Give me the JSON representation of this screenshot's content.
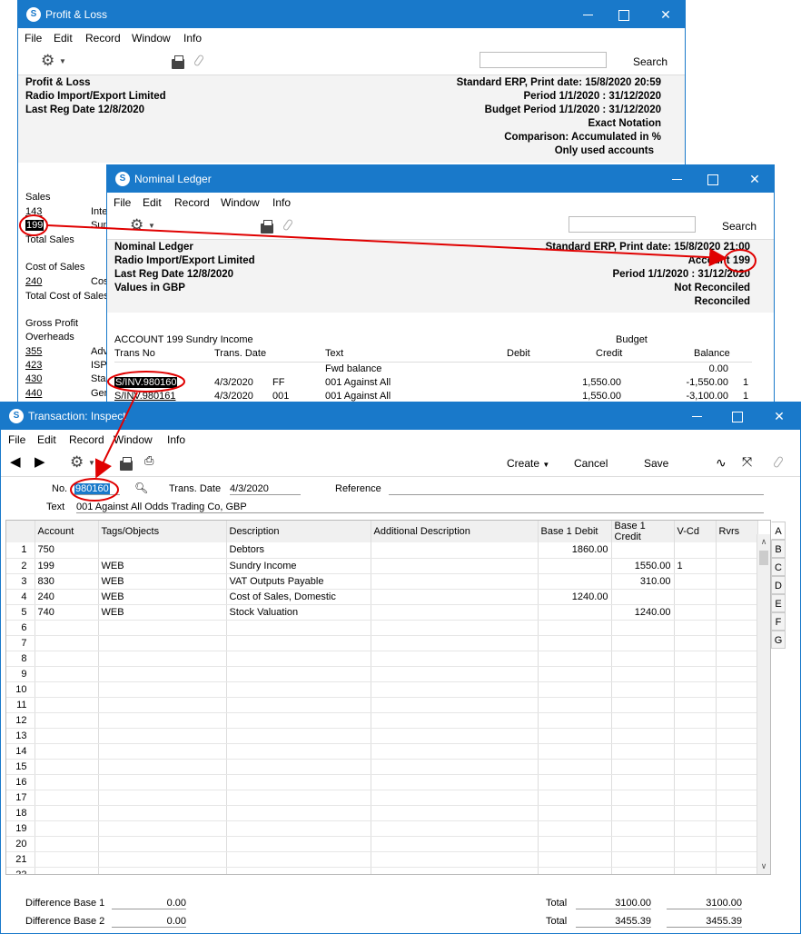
{
  "pl": {
    "title": "Profit & Loss",
    "menu": [
      "File",
      "Edit",
      "Record",
      "Window",
      "Info"
    ],
    "search": "Search",
    "left": [
      "Profit & Loss",
      "Radio Import/Export Limited",
      "Last Reg Date  12/8/2020"
    ],
    "right": [
      "Standard ERP, Print date: 15/8/2020 20:59",
      "Period  1/1/2020 : 31/12/2020",
      "Budget Period  1/1/2020 : 31/12/2020",
      "Exact Notation",
      "Comparison: Accumulated in %",
      "Only used accounts"
    ],
    "body": {
      "sales": "Sales",
      "a143": "143",
      "int": "Inte",
      "a199": "199",
      "sun": "Sun",
      "total_sales": "Total Sales",
      "cost": "Cost of Sales",
      "a240": "240",
      "cos": "Cos",
      "total_cost": "Total Cost of Sales",
      "gross": "Gross Profit",
      "over": "Overheads",
      "a355": "355",
      "adv": "Adv",
      "a423": "423",
      "isp": "ISP",
      "a430": "430",
      "sta": "Sta",
      "a440": "440",
      "gen": "Gen"
    }
  },
  "nl": {
    "title": "Nominal Ledger",
    "menu": [
      "File",
      "Edit",
      "Record",
      "Window",
      "Info"
    ],
    "search": "Search",
    "left": [
      "Nominal Ledger",
      "Radio Import/Export Limited",
      "Last Reg Date  12/8/2020",
      "Values in GBP"
    ],
    "right": [
      "Standard ERP, Print date: 15/8/2020 21:00",
      "Account",
      "199",
      "Period  1/1/2020 : 31/12/2020",
      "Not Reconciled",
      "Reconciled"
    ],
    "account": "ACCOUNT 199  Sundry Income",
    "budget": "Budget",
    "cols": [
      "Trans No",
      "Trans. Date",
      "Text",
      "Debit",
      "Credit",
      "Balance"
    ],
    "fwd": "Fwd balance",
    "fwdval": "0.00",
    "rows": [
      {
        "no": "S/INV.980160",
        "date": "4/3/2020",
        "c": "FF",
        "text": "001 Against All",
        "credit": "1,550.00",
        "bal": "-1,550.00",
        "x": "1"
      },
      {
        "no": "S/INV.980161",
        "date": "4/3/2020",
        "c": "001",
        "text": "001 Against All",
        "credit": "1,550.00",
        "bal": "-3,100.00",
        "x": "1"
      }
    ]
  },
  "tr": {
    "title": "Transaction: Inspect",
    "menu": [
      "File",
      "Edit",
      "Record",
      "Window",
      "Info"
    ],
    "create": "Create",
    "cancel": "Cancel",
    "save": "Save",
    "no_label": "No.",
    "no": "980160",
    "date_label": "Trans. Date",
    "date": "4/3/2020",
    "ref_label": "Reference",
    "text_label": "Text",
    "text": "001 Against All Odds Trading Co, GBP",
    "cols": [
      "Account",
      "Tags/Objects",
      "Description",
      "Additional Description",
      "Base 1 Debit",
      "Base 1 Credit",
      "V-Cd",
      "Rvrs"
    ],
    "rows": [
      [
        "750",
        "",
        "Debtors",
        "",
        "1860.00",
        "",
        "",
        ""
      ],
      [
        "199",
        "WEB",
        "Sundry Income",
        "",
        "",
        "1550.00",
        "1",
        ""
      ],
      [
        "830",
        "WEB",
        "VAT Outputs Payable",
        "",
        "",
        "310.00",
        "",
        ""
      ],
      [
        "240",
        "WEB",
        "Cost of Sales, Domestic",
        "",
        "1240.00",
        "",
        "",
        ""
      ],
      [
        "740",
        "WEB",
        "Stock Valuation",
        "",
        "",
        "1240.00",
        "",
        ""
      ]
    ],
    "tabs": [
      "A",
      "B",
      "C",
      "D",
      "E",
      "F",
      "G"
    ],
    "diff1_label": "Difference Base 1",
    "diff1": "0.00",
    "diff2_label": "Difference Base 2",
    "diff2": "0.00",
    "total_label": "Total",
    "t1a": "3100.00",
    "t1b": "3100.00",
    "t2a": "3455.39",
    "t2b": "3455.39"
  }
}
